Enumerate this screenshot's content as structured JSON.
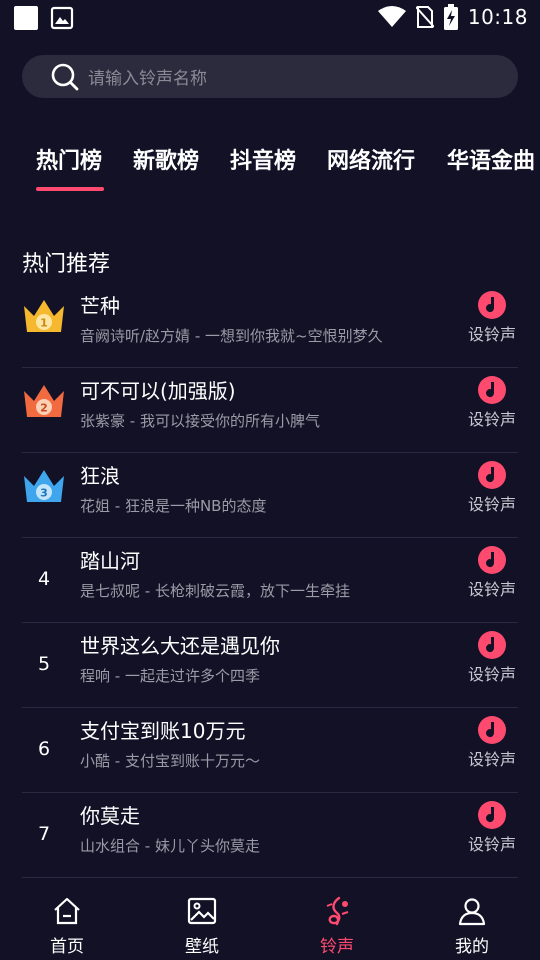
{
  "status_bar": {
    "time": "10:18"
  },
  "search": {
    "placeholder": "请输入铃声名称"
  },
  "tabs": [
    {
      "label": "热门榜",
      "active": true
    },
    {
      "label": "新歌榜",
      "active": false
    },
    {
      "label": "抖音榜",
      "active": false
    },
    {
      "label": "网络流行",
      "active": false
    },
    {
      "label": "华语金曲",
      "active": false
    }
  ],
  "section": {
    "title": "热门推荐"
  },
  "songs": [
    {
      "rank": "1",
      "badge": "gold-crown",
      "title": "芒种",
      "subtitle": "音阙诗听/赵方婧 - 一想到你我就~空恨别梦久",
      "action": "设铃声"
    },
    {
      "rank": "2",
      "badge": "orange-crown",
      "title": "可不可以(加强版)",
      "subtitle": "张紫豪 - 我可以接受你的所有小脾气",
      "action": "设铃声"
    },
    {
      "rank": "3",
      "badge": "blue-crown",
      "title": "狂浪",
      "subtitle": "花姐 - 狂浪是一种NB的态度",
      "action": "设铃声"
    },
    {
      "rank": "4",
      "title": "踏山河",
      "subtitle": "是七叔呢 - 长枪刺破云霞，放下一生牵挂",
      "action": "设铃声"
    },
    {
      "rank": "5",
      "title": "世界这么大还是遇见你",
      "subtitle": "程响 - 一起走过许多个四季",
      "action": "设铃声"
    },
    {
      "rank": "6",
      "title": "支付宝到账10万元",
      "subtitle": "小酷 - 支付宝到账十万元～",
      "action": "设铃声"
    },
    {
      "rank": "7",
      "title": "你莫走",
      "subtitle": "山水组合 - 妹儿丫头你莫走",
      "action": "设铃声"
    }
  ],
  "bottom_nav": [
    {
      "label": "首页",
      "icon": "home-icon",
      "active": false
    },
    {
      "label": "壁纸",
      "icon": "wallpaper-icon",
      "active": false
    },
    {
      "label": "铃声",
      "icon": "ringtone-icon",
      "active": true
    },
    {
      "label": "我的",
      "icon": "profile-icon",
      "active": false
    }
  ],
  "colors": {
    "background": "#121126",
    "accent": "#ff4a6f",
    "crown_gold": "#f5b82e",
    "crown_orange": "#f26a3f",
    "crown_blue": "#3fa5ec"
  }
}
